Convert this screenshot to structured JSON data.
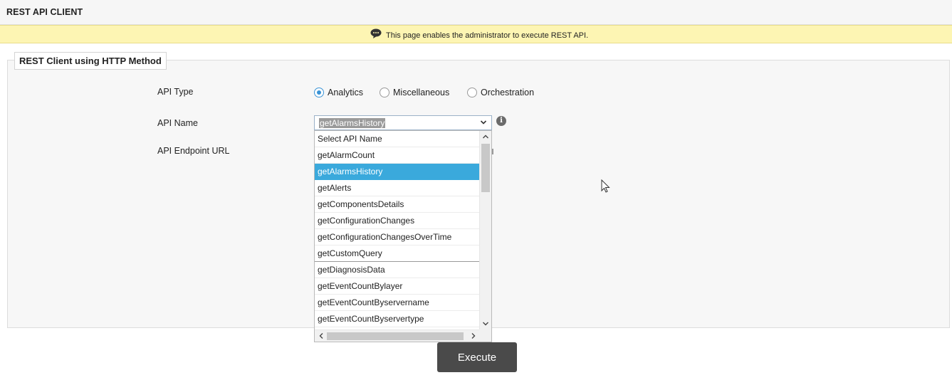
{
  "app": {
    "title": "REST API CLIENT"
  },
  "info": {
    "message": "This page enables the administrator to execute REST API.",
    "icon": "speech-bubble-icon"
  },
  "panel": {
    "legend": "REST Client using HTTP Method"
  },
  "form": {
    "api_type_label": "API Type",
    "api_name_label": "API Name",
    "endpoint_label": "API Endpoint URL",
    "api_types": [
      {
        "label": "Analytics",
        "checked": true
      },
      {
        "label": "Miscellaneous",
        "checked": false
      },
      {
        "label": "Orchestration",
        "checked": false
      }
    ],
    "api_name_selected": "getAlarmsHistory",
    "api_name_options": [
      "Select API Name",
      "getAlarmCount",
      "getAlarmsHistory",
      "getAlerts",
      "getComponentsDetails",
      "getConfigurationChanges",
      "getConfigurationChangesOverTime",
      "getCustomQuery",
      "getDiagnosisData",
      "getEventCountBylayer",
      "getEventCountByservername",
      "getEventCountByservertype"
    ]
  },
  "actions": {
    "execute_label": "Execute"
  },
  "colors": {
    "selected_option": "#3aa9dc",
    "info_bar": "#fdf5b3",
    "execute_button": "#4a4a4a"
  }
}
